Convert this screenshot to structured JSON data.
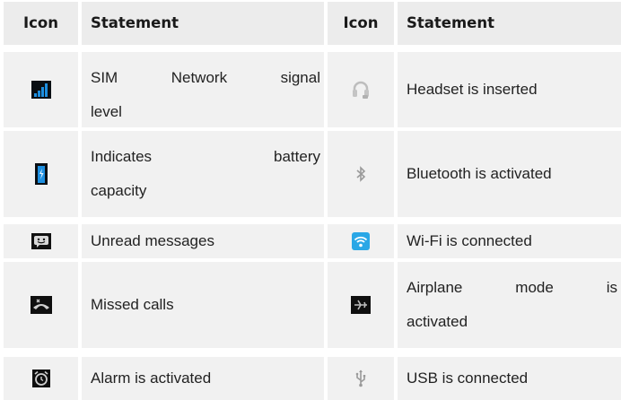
{
  "headers": {
    "left_icon": "Icon",
    "left_statement": "Statement",
    "right_icon": "Icon",
    "right_statement": "Statement"
  },
  "rows": [
    {
      "left": {
        "icon": "signal-bars-icon",
        "statement_line1": "SIM Network signal",
        "statement_line2": "level"
      },
      "right": {
        "icon": "headset-icon",
        "statement": "Headset is inserted"
      }
    },
    {
      "left": {
        "icon": "battery-icon",
        "statement_line1": "Indicates battery",
        "statement_line2": "capacity"
      },
      "right": {
        "icon": "bluetooth-icon",
        "statement": "Bluetooth is activated"
      }
    },
    {
      "left": {
        "icon": "message-icon",
        "statement": "Unread messages"
      },
      "right": {
        "icon": "wifi-icon",
        "statement": "Wi-Fi is connected"
      }
    },
    {
      "left": {
        "icon": "missed-call-icon",
        "statement": "Missed calls"
      },
      "right": {
        "icon": "airplane-icon",
        "statement_line1": "Airplane mode is",
        "statement_line2": "activated"
      }
    },
    {
      "left": {
        "icon": "alarm-icon",
        "statement": "Alarm is activated"
      },
      "right": {
        "icon": "usb-icon",
        "statement": "USB is connected"
      }
    }
  ],
  "colors": {
    "header_bg": "#ececec",
    "cell_bg": "#f1f1f1",
    "signal": "#1e8fe0",
    "wifi": "#2aa7e6"
  }
}
